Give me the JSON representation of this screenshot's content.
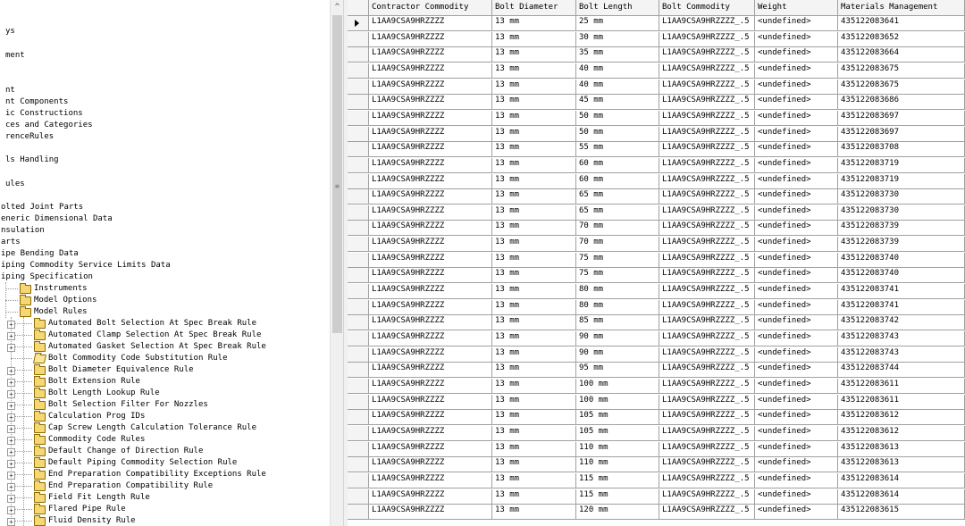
{
  "tree": {
    "top_partial_text": "",
    "items": [
      {
        "label": "ys"
      },
      {
        "label": "ment"
      },
      {
        "label": "nt"
      },
      {
        "label": "nt Components"
      },
      {
        "label": "ic Constructions"
      },
      {
        "label": "ces and Categories"
      },
      {
        "label": "renceRules"
      },
      {
        "label": "ls Handling"
      },
      {
        "label": "ules"
      },
      {
        "label": "olted Joint Parts"
      },
      {
        "label": "eneric Dimensional Data"
      },
      {
        "label": "nsulation"
      },
      {
        "label": "arts"
      },
      {
        "label": "ipe Bending Data"
      },
      {
        "label": "iping Commodity Service Limits Data"
      },
      {
        "label": "iping Specification"
      },
      {
        "label": "Instruments"
      },
      {
        "label": "Model Options"
      },
      {
        "label": "Model Rules"
      },
      {
        "label": "Automated Bolt Selection At Spec Break Rule"
      },
      {
        "label": "Automated Clamp Selection At Spec Break Rule"
      },
      {
        "label": "Automated Gasket Selection At Spec Break Rule"
      },
      {
        "label": "Bolt Commodity Code Substitution Rule"
      },
      {
        "label": "Bolt Diameter Equivalence Rule"
      },
      {
        "label": "Bolt Extension Rule"
      },
      {
        "label": "Bolt Length Lookup Rule"
      },
      {
        "label": "Bolt Selection Filter For Nozzles"
      },
      {
        "label": "Calculation Prog IDs"
      },
      {
        "label": "Cap Screw Length Calculation Tolerance Rule"
      },
      {
        "label": "Commodity Code Rules"
      },
      {
        "label": "Default Change of Direction Rule"
      },
      {
        "label": "Default Piping Commodity Selection Rule"
      },
      {
        "label": "End Preparation Compatibility Exceptions Rule"
      },
      {
        "label": "End Preparation Compatibility Rule"
      },
      {
        "label": "Field Fit Length Rule"
      },
      {
        "label": "Flared Pipe Rule"
      },
      {
        "label": "Fluid Density Rule"
      }
    ]
  },
  "grid": {
    "columns": [
      "Contractor Commodity",
      "Bolt Diameter",
      "Bolt Length",
      "Bolt Commodity",
      "Weight",
      "Materials Management"
    ],
    "rows": [
      [
        "L1AA9CSA9HRZZZZ",
        "13 mm",
        "25 mm",
        "L1AA9CSA9HRZZZZ_.5",
        "<undefined>",
        "435122083641"
      ],
      [
        "L1AA9CSA9HRZZZZ",
        "13 mm",
        "30 mm",
        "L1AA9CSA9HRZZZZ_.5",
        "<undefined>",
        "435122083652"
      ],
      [
        "L1AA9CSA9HRZZZZ",
        "13 mm",
        "35 mm",
        "L1AA9CSA9HRZZZZ_.5",
        "<undefined>",
        "435122083664"
      ],
      [
        "L1AA9CSA9HRZZZZ",
        "13 mm",
        "40 mm",
        "L1AA9CSA9HRZZZZ_.5",
        "<undefined>",
        "435122083675"
      ],
      [
        "L1AA9CSA9HRZZZZ",
        "13 mm",
        "40 mm",
        "L1AA9CSA9HRZZZZ_.5",
        "<undefined>",
        "435122083675"
      ],
      [
        "L1AA9CSA9HRZZZZ",
        "13 mm",
        "45 mm",
        "L1AA9CSA9HRZZZZ_.5",
        "<undefined>",
        "435122083686"
      ],
      [
        "L1AA9CSA9HRZZZZ",
        "13 mm",
        "50 mm",
        "L1AA9CSA9HRZZZZ_.5",
        "<undefined>",
        "435122083697"
      ],
      [
        "L1AA9CSA9HRZZZZ",
        "13 mm",
        "50 mm",
        "L1AA9CSA9HRZZZZ_.5",
        "<undefined>",
        "435122083697"
      ],
      [
        "L1AA9CSA9HRZZZZ",
        "13 mm",
        "55 mm",
        "L1AA9CSA9HRZZZZ_.5",
        "<undefined>",
        "435122083708"
      ],
      [
        "L1AA9CSA9HRZZZZ",
        "13 mm",
        "60 mm",
        "L1AA9CSA9HRZZZZ_.5",
        "<undefined>",
        "435122083719"
      ],
      [
        "L1AA9CSA9HRZZZZ",
        "13 mm",
        "60 mm",
        "L1AA9CSA9HRZZZZ_.5",
        "<undefined>",
        "435122083719"
      ],
      [
        "L1AA9CSA9HRZZZZ",
        "13 mm",
        "65 mm",
        "L1AA9CSA9HRZZZZ_.5",
        "<undefined>",
        "435122083730"
      ],
      [
        "L1AA9CSA9HRZZZZ",
        "13 mm",
        "65 mm",
        "L1AA9CSA9HRZZZZ_.5",
        "<undefined>",
        "435122083730"
      ],
      [
        "L1AA9CSA9HRZZZZ",
        "13 mm",
        "70 mm",
        "L1AA9CSA9HRZZZZ_.5",
        "<undefined>",
        "435122083739"
      ],
      [
        "L1AA9CSA9HRZZZZ",
        "13 mm",
        "70 mm",
        "L1AA9CSA9HRZZZZ_.5",
        "<undefined>",
        "435122083739"
      ],
      [
        "L1AA9CSA9HRZZZZ",
        "13 mm",
        "75 mm",
        "L1AA9CSA9HRZZZZ_.5",
        "<undefined>",
        "435122083740"
      ],
      [
        "L1AA9CSA9HRZZZZ",
        "13 mm",
        "75 mm",
        "L1AA9CSA9HRZZZZ_.5",
        "<undefined>",
        "435122083740"
      ],
      [
        "L1AA9CSA9HRZZZZ",
        "13 mm",
        "80 mm",
        "L1AA9CSA9HRZZZZ_.5",
        "<undefined>",
        "435122083741"
      ],
      [
        "L1AA9CSA9HRZZZZ",
        "13 mm",
        "80 mm",
        "L1AA9CSA9HRZZZZ_.5",
        "<undefined>",
        "435122083741"
      ],
      [
        "L1AA9CSA9HRZZZZ",
        "13 mm",
        "85 mm",
        "L1AA9CSA9HRZZZZ_.5",
        "<undefined>",
        "435122083742"
      ],
      [
        "L1AA9CSA9HRZZZZ",
        "13 mm",
        "90 mm",
        "L1AA9CSA9HRZZZZ_.5",
        "<undefined>",
        "435122083743"
      ],
      [
        "L1AA9CSA9HRZZZZ",
        "13 mm",
        "90 mm",
        "L1AA9CSA9HRZZZZ_.5",
        "<undefined>",
        "435122083743"
      ],
      [
        "L1AA9CSA9HRZZZZ",
        "13 mm",
        "95 mm",
        "L1AA9CSA9HRZZZZ_.5",
        "<undefined>",
        "435122083744"
      ],
      [
        "L1AA9CSA9HRZZZZ",
        "13 mm",
        "100 mm",
        "L1AA9CSA9HRZZZZ_.5",
        "<undefined>",
        "435122083611"
      ],
      [
        "L1AA9CSA9HRZZZZ",
        "13 mm",
        "100 mm",
        "L1AA9CSA9HRZZZZ_.5",
        "<undefined>",
        "435122083611"
      ],
      [
        "L1AA9CSA9HRZZZZ",
        "13 mm",
        "105 mm",
        "L1AA9CSA9HRZZZZ_.5",
        "<undefined>",
        "435122083612"
      ],
      [
        "L1AA9CSA9HRZZZZ",
        "13 mm",
        "105 mm",
        "L1AA9CSA9HRZZZZ_.5",
        "<undefined>",
        "435122083612"
      ],
      [
        "L1AA9CSA9HRZZZZ",
        "13 mm",
        "110 mm",
        "L1AA9CSA9HRZZZZ_.5",
        "<undefined>",
        "435122083613"
      ],
      [
        "L1AA9CSA9HRZZZZ",
        "13 mm",
        "110 mm",
        "L1AA9CSA9HRZZZZ_.5",
        "<undefined>",
        "435122083613"
      ],
      [
        "L1AA9CSA9HRZZZZ",
        "13 mm",
        "115 mm",
        "L1AA9CSA9HRZZZZ_.5",
        "<undefined>",
        "435122083614"
      ],
      [
        "L1AA9CSA9HRZZZZ",
        "13 mm",
        "115 mm",
        "L1AA9CSA9HRZZZZ_.5",
        "<undefined>",
        "435122083614"
      ],
      [
        "L1AA9CSA9HRZZZZ",
        "13 mm",
        "120 mm",
        "L1AA9CSA9HRZZZZ_.5",
        "<undefined>",
        "435122083615"
      ]
    ]
  },
  "icons": {
    "expand": "plus-expander-icon",
    "collapse": "minus-expander-icon",
    "folder": "folder-icon",
    "open_folder": "open-folder-icon",
    "row_pointer": "row-pointer-icon",
    "scroll_up": "scroll-up-arrow-icon",
    "grip": "scroll-grip-icon"
  },
  "glyphs": {
    "plus": "+",
    "minus": "−",
    "scroll_up": "^",
    "grip": "≡"
  }
}
